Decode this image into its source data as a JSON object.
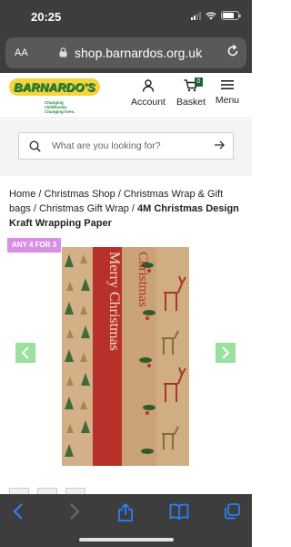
{
  "status_bar": {
    "time": "20:25"
  },
  "browser": {
    "text_size_label": "AA",
    "url": "shop.barnardos.org.uk"
  },
  "header": {
    "logo_text": "BARNARDO'S",
    "logo_tagline": "Changing childhoods. Changing lives.",
    "account_label": "Account",
    "basket_label": "Basket",
    "basket_count": "0",
    "menu_label": "Menu"
  },
  "search": {
    "placeholder": "What are you looking for?"
  },
  "breadcrumb": {
    "items": [
      "Home",
      "Christmas Shop",
      "Christmas Wrap & Gift bags",
      "Christmas Gift Wrap"
    ],
    "separator": " / ",
    "current": "4M Christmas Design Kraft Wrapping Paper"
  },
  "product": {
    "promo_badge": "ANY 4 FOR 3",
    "image_text_a": "Merry Christmas",
    "image_text_b": "Christmas"
  },
  "colors": {
    "brand_green": "#2a8a3a",
    "brand_yellow": "#f7d33c",
    "promo_pink": "#d98fe6",
    "carousel_arrow": "#9ae09e",
    "ios_accent": "#2d7ff9"
  },
  "icons": {
    "lock": "lock-icon",
    "reload": "reload-icon",
    "account": "user-icon",
    "basket": "cart-icon",
    "menu": "hamburger-icon",
    "search": "search-icon",
    "go": "arrow-right-icon",
    "back": "back-icon",
    "forward": "forward-icon",
    "share": "share-icon",
    "bookmarks": "bookmarks-icon",
    "tabs": "tabs-icon"
  }
}
